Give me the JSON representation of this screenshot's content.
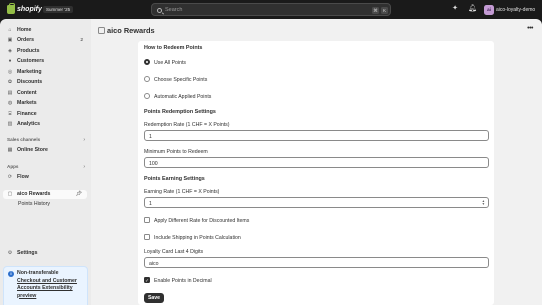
{
  "topbar": {
    "brand": "shopify",
    "edition_badge": "Summer '25",
    "search_placeholder": "Search",
    "shortcut_keys": [
      "⌘",
      "K"
    ],
    "store_initials": "ai",
    "store_name": "aico-loyalty-demo"
  },
  "sidebar": {
    "items": [
      {
        "label": "Home",
        "icon": "home-icon"
      },
      {
        "label": "Orders",
        "icon": "orders-icon",
        "badge": "2"
      },
      {
        "label": "Products",
        "icon": "tag-icon"
      },
      {
        "label": "Customers",
        "icon": "person-icon"
      },
      {
        "label": "Marketing",
        "icon": "target-icon"
      },
      {
        "label": "Discounts",
        "icon": "discount-icon"
      },
      {
        "label": "Content",
        "icon": "content-icon"
      },
      {
        "label": "Markets",
        "icon": "globe-icon"
      },
      {
        "label": "Finance",
        "icon": "bank-icon"
      },
      {
        "label": "Analytics",
        "icon": "chart-icon"
      }
    ],
    "sales_channels_label": "Sales channels",
    "online_store_label": "Online Store",
    "apps_label": "Apps",
    "flow_label": "Flow",
    "app_label": "aico Rewards",
    "app_sub_label": "Points History",
    "settings_label": "Settings",
    "notice": {
      "title": "Non-transferable",
      "link": "Checkout and Customer Accounts Extensibility",
      "suffix": "preview"
    }
  },
  "main": {
    "title": "aico Rewards",
    "redeem_heading": "How to Redeem Points",
    "redeem_options": [
      "Use All Points",
      "Choose Specific Points",
      "Automatic Applied Points"
    ],
    "redeem_selected": 0,
    "redemption_settings_heading": "Points Redemption Settings",
    "redemption_rate_label": "Redemption Rate (1 CHF = X Points)",
    "redemption_rate_value": "1",
    "min_points_label": "Minimum Points to Redeem",
    "min_points_value": "100",
    "earning_settings_heading": "Points Earning Settings",
    "earning_rate_label": "Earning Rate (1 CHF = X Points)",
    "earning_rate_value": "1",
    "discounted_items_label": "Apply Different Rate for Discounted Items",
    "discounted_items_checked": false,
    "include_shipping_label": "Include Shipping in Points Calculation",
    "include_shipping_checked": false,
    "loyalty_card_label": "Loyalty Card Last 4 Digits",
    "loyalty_card_value": "aico",
    "decimal_label": "Enable Points in Decimal",
    "decimal_checked": true,
    "save_label": "Save"
  }
}
